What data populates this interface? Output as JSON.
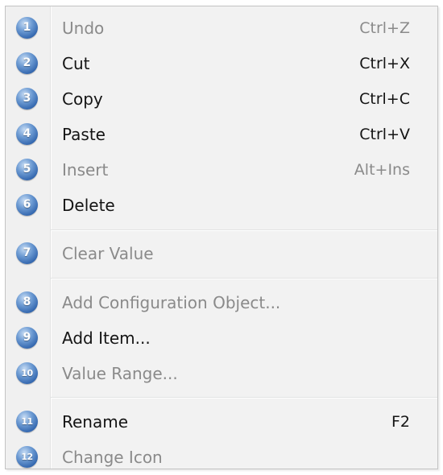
{
  "menu": {
    "items": [
      {
        "num": "1",
        "label": "Undo",
        "shortcut": "Ctrl+Z",
        "enabled": false
      },
      {
        "num": "2",
        "label": "Cut",
        "shortcut": "Ctrl+X",
        "enabled": true
      },
      {
        "num": "3",
        "label": "Copy",
        "shortcut": "Ctrl+C",
        "enabled": true
      },
      {
        "num": "4",
        "label": "Paste",
        "shortcut": "Ctrl+V",
        "enabled": true
      },
      {
        "num": "5",
        "label": "Insert",
        "shortcut": "Alt+Ins",
        "enabled": false
      },
      {
        "num": "6",
        "label": "Delete",
        "shortcut": "",
        "enabled": true
      },
      {
        "num": "7",
        "label": "Clear Value",
        "shortcut": "",
        "enabled": false
      },
      {
        "num": "8",
        "label": "Add Configuration Object...",
        "shortcut": "",
        "enabled": false
      },
      {
        "num": "9",
        "label": "Add Item...",
        "shortcut": "",
        "enabled": true
      },
      {
        "num": "10",
        "label": "Value Range...",
        "shortcut": "",
        "enabled": false
      },
      {
        "num": "11",
        "label": "Rename",
        "shortcut": "F2",
        "enabled": true
      },
      {
        "num": "12",
        "label": "Change Icon",
        "shortcut": "",
        "enabled": false
      }
    ]
  },
  "colors": {
    "badge": "#3a70b8",
    "enabled_text": "#141414",
    "disabled_text": "#8a8a8a",
    "menu_background": "#f2f2f2"
  }
}
